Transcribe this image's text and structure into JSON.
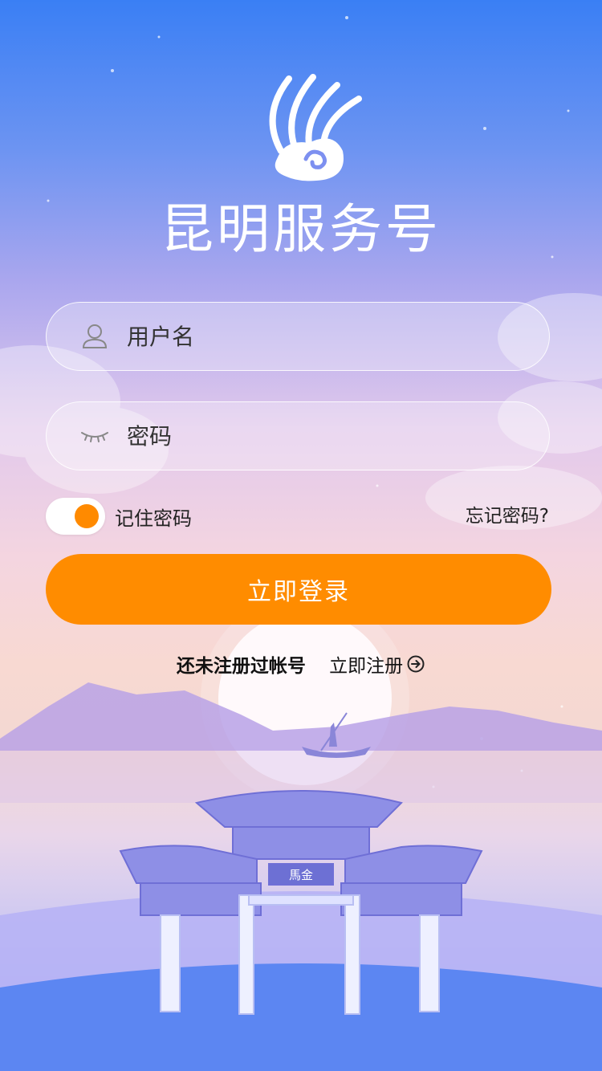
{
  "app": {
    "title": "昆明服务号"
  },
  "login_form": {
    "username_placeholder": "用户名",
    "password_placeholder": "密码",
    "remember_label": "记住密码",
    "remember_on": true,
    "forgot_label": "忘记密码?",
    "submit_label": "立即登录"
  },
  "register": {
    "prompt": "还未注册过帐号",
    "link_label": "立即注册"
  },
  "scene": {
    "gate_plaque": "馬金"
  },
  "colors": {
    "accent": "#ff8c00",
    "top": "#3a7ff4"
  },
  "icons": {
    "logo": "cloud-wing-logo",
    "username": "user-icon",
    "password": "eye-closed-icon",
    "register": "arrow-circle-right-icon"
  }
}
